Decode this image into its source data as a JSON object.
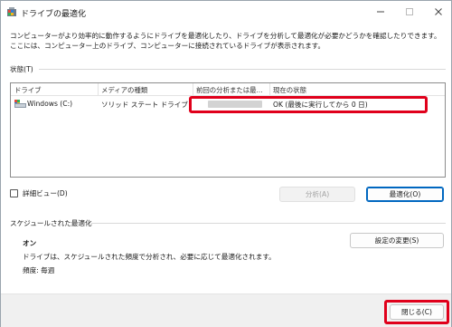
{
  "window": {
    "title": "ドライブの最適化",
    "description": "コンピューターがより効率的に動作するようにドライブを最適化したり、ドライブを分析して最適化が必要かどうかを確認したりできます。ここには、コンピューター上のドライブ、コンピューターに接続されているドライブが表示されます。"
  },
  "status_section": {
    "label": "状態(T)",
    "columns": [
      "ドライブ",
      "メディアの種類",
      "前回の分析または最...",
      "現在の状態"
    ],
    "rows": [
      {
        "drive": "Windows (C:)",
        "media": "ソリッド ステート ドライブ",
        "last": "",
        "status": "OK (最後に実行してから 0 日)"
      }
    ]
  },
  "controls": {
    "detail_view_label": "詳細ビュー(D)",
    "analyze_label": "分析(A)",
    "optimize_label": "最適化(O)"
  },
  "schedule": {
    "label": "スケジュールされた最適化",
    "state": "オン",
    "description": "ドライブは、スケジュールされた頻度で分析され、必要に応じて最適化されます。",
    "frequency": "頻度: 毎週",
    "change_settings_label": "設定の変更(S)"
  },
  "footer": {
    "close_label": "閉じる(C)"
  },
  "colors": {
    "highlight": "#e0001b",
    "accent": "#0067c0"
  }
}
